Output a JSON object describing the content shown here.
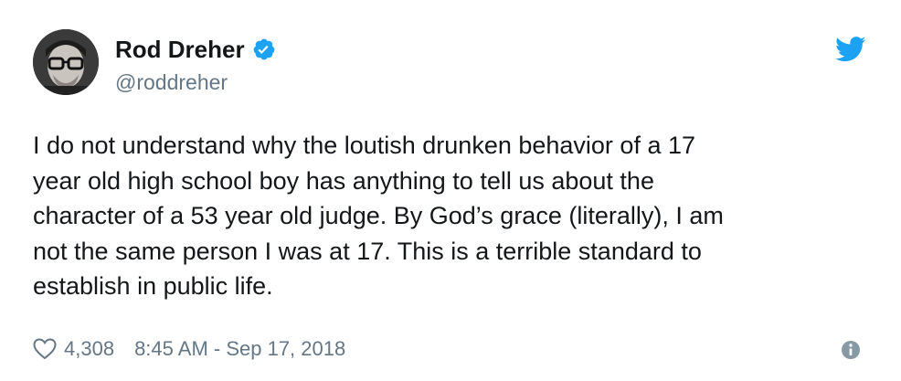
{
  "author": {
    "display_name": "Rod Dreher",
    "handle": "@roddreher",
    "verified": true
  },
  "tweet": {
    "text": "I do not understand why the loutish drunken behavior of a 17\nyear old high school boy has anything to tell us about the\ncharacter of a 53 year old judge. By God’s grace (literally), I am\nnot the same person I was at 17. This is a terrible standard to\nestablish in public life."
  },
  "footer": {
    "like_count": "4,308",
    "timestamp": "8:45 AM - Sep 17, 2018"
  },
  "icons": {
    "verified": "verified-badge-icon",
    "brand": "twitter-bird-icon",
    "like": "heart-icon",
    "info": "info-icon"
  },
  "colors": {
    "brand_blue": "#1da1f2",
    "secondary_text": "#657786",
    "primary_text": "#14171a"
  }
}
